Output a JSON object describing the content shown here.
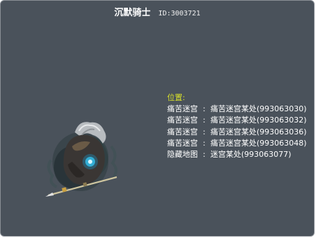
{
  "monster": {
    "name": "沉默骑士",
    "id_text": "ID:3003721",
    "icon": "monster-sprite-icon"
  },
  "location": {
    "title": "位置:",
    "entries": [
      {
        "map": "痛苦迷宫",
        "sep": ":",
        "place": "痛苦迷宫某处(993063030)"
      },
      {
        "map": "痛苦迷宫",
        "sep": ":",
        "place": "痛苦迷宫某处(993063032)"
      },
      {
        "map": "痛苦迷宫",
        "sep": ":",
        "place": "痛苦迷宫某处(993063036)"
      },
      {
        "map": "痛苦迷宫",
        "sep": ":",
        "place": "痛苦迷宫某处(993063048)"
      },
      {
        "map": "隐藏地图",
        "sep": ":",
        "place": "迷宫某处(993063077)"
      }
    ]
  },
  "colors": {
    "panel_bg": "#4a525b",
    "title_accent": "#d8e02a",
    "text": "#ffffff"
  }
}
